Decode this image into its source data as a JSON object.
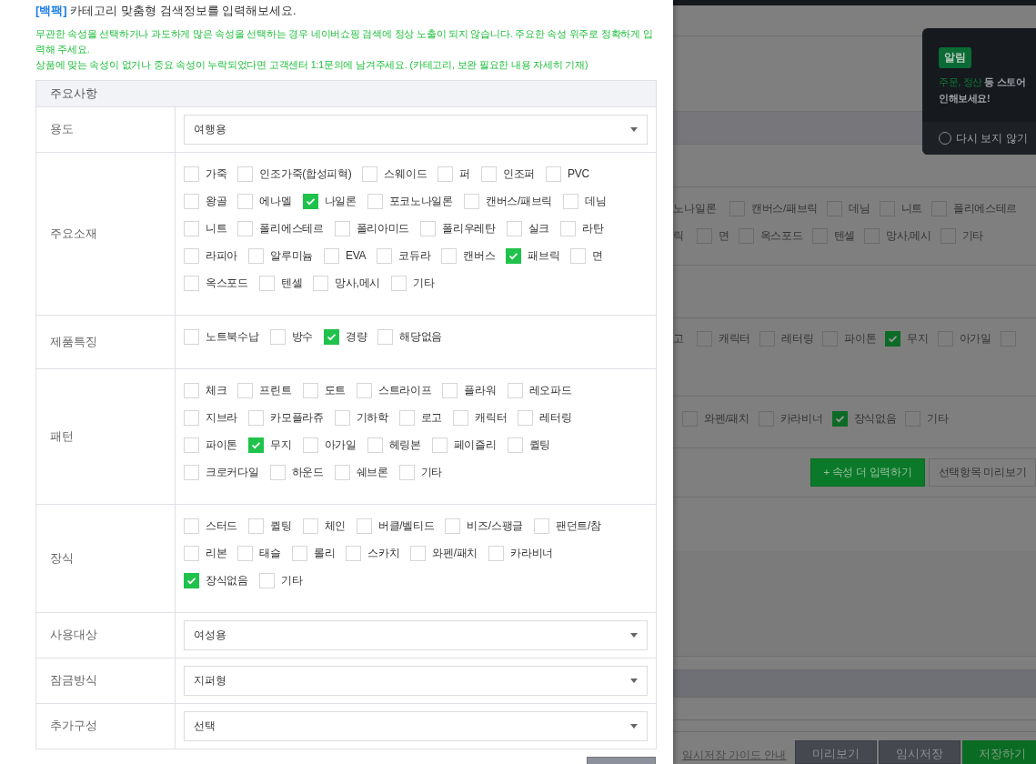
{
  "modal": {
    "heading_tag": "[백팩]",
    "heading": "카테고리 맞춤형 검색정보를 입력해보세요.",
    "notices": [
      "무관한 속성을 선택하거나 과도하게 많은 속성을 선택하는 경우 네이버쇼핑 검색에 정상 노출이 되지 않습니다. 주요한 속성 위주로 정확하게 입력해 주세요.",
      "상품에 맞는 속성이 없거나 중요 속성이 누락되었다면 고객센터 1:1문의에 남겨주세요. (카테고리, 보완 필요한 내용 자세히 기재)"
    ],
    "table": {
      "header": "주요사항",
      "rows": [
        {
          "kind": "select",
          "label": "용도",
          "value": "여행용"
        },
        {
          "kind": "checks",
          "label": "주요소재",
          "lines": [
            [
              {
                "label": "가죽",
                "checked": false
              },
              {
                "label": "인조가죽(합성피혁)",
                "checked": false
              },
              {
                "label": "스웨이드",
                "checked": false
              },
              {
                "label": "퍼",
                "checked": false
              },
              {
                "label": "인조퍼",
                "checked": false
              },
              {
                "label": "PVC",
                "checked": false
              }
            ],
            [
              {
                "label": "왕골",
                "checked": false
              },
              {
                "label": "에나멜",
                "checked": false
              },
              {
                "label": "나일론",
                "checked": true
              },
              {
                "label": "포코노나일론",
                "checked": false
              },
              {
                "label": "캔버스/패브릭",
                "checked": false
              },
              {
                "label": "데님",
                "checked": false
              }
            ],
            [
              {
                "label": "니트",
                "checked": false
              },
              {
                "label": "폴리에스테르",
                "checked": false
              },
              {
                "label": "폴리아미드",
                "checked": false
              },
              {
                "label": "폴리우레탄",
                "checked": false
              },
              {
                "label": "실크",
                "checked": false
              },
              {
                "label": "라탄",
                "checked": false
              }
            ],
            [
              {
                "label": "라피아",
                "checked": false
              },
              {
                "label": "알루미늄",
                "checked": false
              },
              {
                "label": "EVA",
                "checked": false
              },
              {
                "label": "코듀라",
                "checked": false
              },
              {
                "label": "캔버스",
                "checked": false
              },
              {
                "label": "패브릭",
                "checked": true
              },
              {
                "label": "면",
                "checked": false
              }
            ],
            [
              {
                "label": "옥스포드",
                "checked": false
              },
              {
                "label": "텐셀",
                "checked": false
              },
              {
                "label": "망사,메시",
                "checked": false
              },
              {
                "label": "기타",
                "checked": false
              }
            ]
          ]
        },
        {
          "kind": "checks",
          "label": "제품특징",
          "lines": [
            [
              {
                "label": "노트북수납",
                "checked": false
              },
              {
                "label": "방수",
                "checked": false
              },
              {
                "label": "경량",
                "checked": true
              },
              {
                "label": "해당없음",
                "checked": false
              }
            ]
          ]
        },
        {
          "kind": "checks",
          "label": "패턴",
          "lines": [
            [
              {
                "label": "체크",
                "checked": false
              },
              {
                "label": "프린트",
                "checked": false
              },
              {
                "label": "도트",
                "checked": false
              },
              {
                "label": "스트라이프",
                "checked": false
              },
              {
                "label": "플라워",
                "checked": false
              },
              {
                "label": "레오파드",
                "checked": false
              }
            ],
            [
              {
                "label": "지브라",
                "checked": false
              },
              {
                "label": "카모플라쥬",
                "checked": false
              },
              {
                "label": "기하학",
                "checked": false
              },
              {
                "label": "로고",
                "checked": false
              },
              {
                "label": "캐릭터",
                "checked": false
              },
              {
                "label": "레터링",
                "checked": false
              }
            ],
            [
              {
                "label": "파이톤",
                "checked": false
              },
              {
                "label": "무지",
                "checked": true
              },
              {
                "label": "아가일",
                "checked": false
              },
              {
                "label": "헤링본",
                "checked": false
              },
              {
                "label": "페이즐리",
                "checked": false
              },
              {
                "label": "퀼팅",
                "checked": false
              }
            ],
            [
              {
                "label": "크로커다일",
                "checked": false
              },
              {
                "label": "하운드",
                "checked": false
              },
              {
                "label": "쉐브론",
                "checked": false
              },
              {
                "label": "기타",
                "checked": false
              }
            ]
          ]
        },
        {
          "kind": "checks",
          "label": "장식",
          "lines": [
            [
              {
                "label": "스터드",
                "checked": false
              },
              {
                "label": "퀼팅",
                "checked": false
              },
              {
                "label": "체인",
                "checked": false
              },
              {
                "label": "버클/벨티드",
                "checked": false
              },
              {
                "label": "비즈/스팽글",
                "checked": false
              },
              {
                "label": "팬던트/참",
                "checked": false
              }
            ],
            [
              {
                "label": "리본",
                "checked": false
              },
              {
                "label": "태슬",
                "checked": false
              },
              {
                "label": "롤리",
                "checked": false
              },
              {
                "label": "스카치",
                "checked": false
              },
              {
                "label": "와펜/패치",
                "checked": false
              },
              {
                "label": "카라비너",
                "checked": false
              }
            ],
            [
              {
                "label": "장식없음",
                "checked": true
              },
              {
                "label": "기타",
                "checked": false
              }
            ]
          ]
        },
        {
          "kind": "select",
          "label": "사용대상",
          "value": "여성용"
        },
        {
          "kind": "select",
          "label": "잠금방식",
          "value": "지퍼형"
        },
        {
          "kind": "select",
          "label": "추가구성",
          "value": "선택"
        }
      ]
    }
  },
  "background": {
    "material_lines": [
      [
        {
          "kind": "fragment",
          "label": "노나일론"
        },
        {
          "kind": "option",
          "label": "캔버스/패브릭",
          "checked": false
        },
        {
          "kind": "option",
          "label": "데님",
          "checked": false
        },
        {
          "kind": "option",
          "label": "니트",
          "checked": false
        },
        {
          "kind": "option",
          "label": "폴리에스테르",
          "checked": false
        }
      ],
      [
        {
          "kind": "fragment",
          "label": "릭"
        },
        {
          "kind": "option",
          "label": "면",
          "checked": false
        },
        {
          "kind": "option",
          "label": "옥스포드",
          "checked": false
        },
        {
          "kind": "option",
          "label": "텐셀",
          "checked": false
        },
        {
          "kind": "option",
          "label": "망사,메시",
          "checked": false
        },
        {
          "kind": "option",
          "label": "기타",
          "checked": false
        }
      ]
    ],
    "pattern_line": [
      {
        "kind": "fragment",
        "label": "고"
      },
      {
        "kind": "option",
        "label": "캐릭터",
        "checked": false
      },
      {
        "kind": "option",
        "label": "레터링",
        "checked": false
      },
      {
        "kind": "option",
        "label": "파이톤",
        "checked": false
      },
      {
        "kind": "option",
        "label": "무지",
        "checked": true
      },
      {
        "kind": "option",
        "label": "아가일",
        "checked": false
      },
      {
        "kind": "option",
        "checked": false
      }
    ],
    "decoration_line": [
      {
        "kind": "option",
        "label": "와펜/패치",
        "checked": false
      },
      {
        "kind": "option",
        "label": "카라비너",
        "checked": false
      },
      {
        "kind": "option",
        "label": "장식없음",
        "checked": true
      },
      {
        "kind": "option",
        "label": "기타",
        "checked": false
      }
    ],
    "actions": [
      {
        "kind": "primary",
        "label": "+ 속성 더 입력하기"
      },
      {
        "kind": "secondary",
        "label": "선택항목 미리보기"
      }
    ],
    "guide_link": "임시저장 가이드 안내",
    "footer_buttons": [
      {
        "kind": "dark",
        "label": "미리보기"
      },
      {
        "kind": "dark",
        "label": "임시저장"
      },
      {
        "kind": "primary",
        "label": "저장하기"
      }
    ]
  },
  "toast": {
    "badge": "알림",
    "highlight": "주문, 정산",
    "message": "등 스토어",
    "message_line2": "인해보세요!",
    "dismiss": "다시 보지 않기",
    "dismiss_checked": false
  }
}
